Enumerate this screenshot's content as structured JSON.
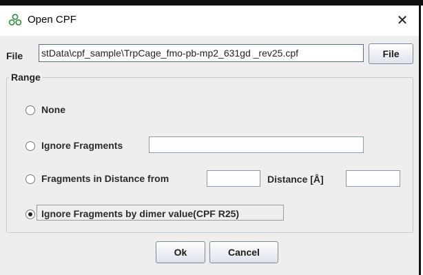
{
  "window": {
    "title": "Open CPF",
    "close_glyph": "✕",
    "app_icon": "app-icon"
  },
  "file": {
    "label": "File",
    "path_value": "stData\\cpf_sample\\TrpCage_fmo-pb-mp2_631gd _rev25.cpf",
    "browse_label": "File"
  },
  "range": {
    "legend": "Range",
    "selected": "ignore_by_dimer",
    "options": {
      "none": "None",
      "ignore_fragments": "Ignore Fragments",
      "fragments_in_distance": "Fragments in Distance  from",
      "ignore_by_dimer": "Ignore Fragments by dimer value(CPF R25)"
    },
    "ignore_fragments_value": "",
    "distance_from_value": "",
    "distance_label": "Distance [Å]",
    "distance_value": ""
  },
  "buttons": {
    "ok_label": "Ok",
    "cancel_label": "Cancel"
  },
  "colors": {
    "dialog_bg": "#eeeeee",
    "titlebar_bg": "#ffffff",
    "icon_green": "#2e8b3e"
  }
}
